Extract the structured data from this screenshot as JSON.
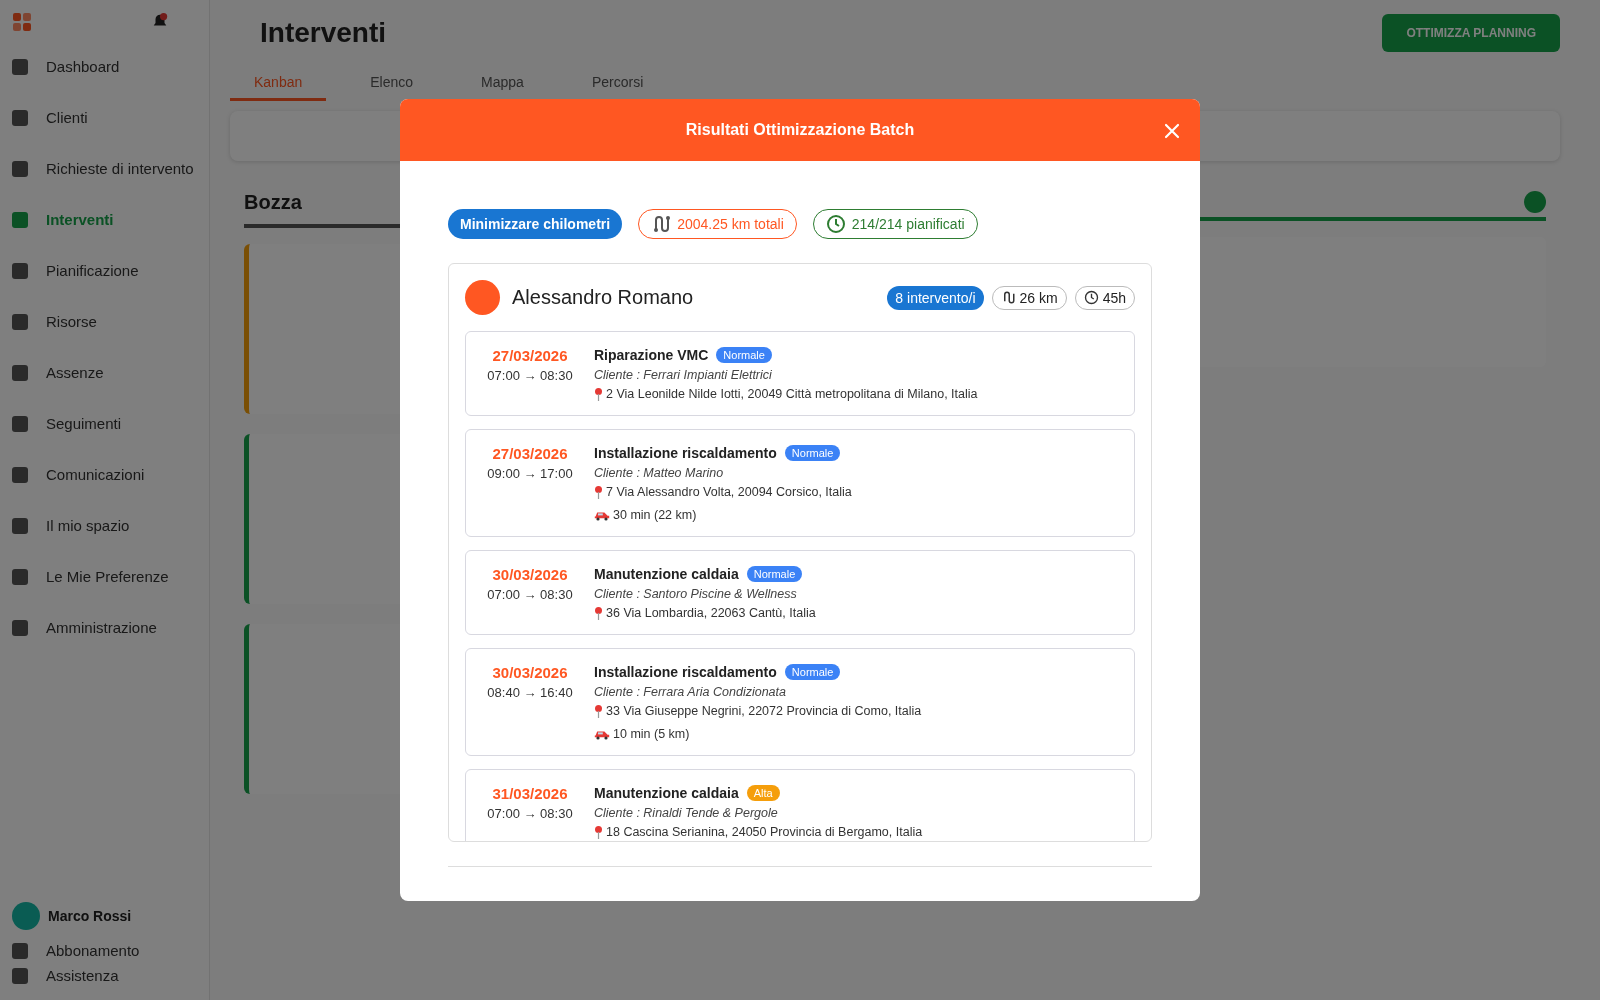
{
  "sidebar": {
    "items": [
      {
        "label": "Dashboard",
        "selected": false
      },
      {
        "label": "Clienti",
        "selected": false
      },
      {
        "label": "Richieste di intervento",
        "selected": false
      },
      {
        "label": "Interventi",
        "selected": true
      },
      {
        "label": "Pianificazione",
        "selected": false
      },
      {
        "label": "Risorse",
        "selected": false
      },
      {
        "label": "Assenze",
        "selected": false
      },
      {
        "label": "Seguimenti",
        "selected": false
      },
      {
        "label": "Comunicazioni",
        "selected": false
      },
      {
        "label": "Il mio spazio",
        "selected": false
      },
      {
        "label": "Le Mie Preferenze",
        "selected": false
      },
      {
        "label": "Amministrazione",
        "selected": false
      }
    ],
    "user": {
      "name": "Marco Rossi"
    },
    "footer_items": [
      "Abbonamento",
      "Assistenza"
    ]
  },
  "page": {
    "title": "Interventi",
    "action_button": "OTTIMIZZA PLANNING",
    "tabs": [
      {
        "label": "Kanban",
        "selected": true
      },
      {
        "label": "Elenco",
        "selected": false
      },
      {
        "label": "Mappa",
        "selected": false
      },
      {
        "label": "Percorsi",
        "selected": false
      }
    ],
    "columns": [
      {
        "title": "Bozza"
      }
    ]
  },
  "modal": {
    "title": "Risultati Ottimizzazione Batch",
    "chips": [
      {
        "kind": "mode",
        "label": "Minimizzare chilometri"
      },
      {
        "kind": "distance",
        "label": "2004.25 km totali"
      },
      {
        "kind": "planned",
        "label": "214/214 pianificati"
      }
    ],
    "resource": {
      "name": "Alessandro Romano",
      "count": "8 intervento/i",
      "km": "26 km",
      "hours": "45h",
      "interventions": [
        {
          "date": "27/03/2026",
          "time": "07:00 → 08:30",
          "title": "Riparazione VMC",
          "priority": {
            "kind": "normal",
            "label": "Normale"
          },
          "client": "Cliente : Ferrari Impianti Elettrici",
          "address": "2 Via Leonilde Nilde Iotti, 20049 Città metropolitana di Milano, Italia"
        },
        {
          "date": "27/03/2026",
          "time": "09:00 → 17:00",
          "title": "Installazione riscaldamento",
          "priority": {
            "kind": "normal",
            "label": "Normale"
          },
          "client": "Cliente : Matteo Marino",
          "address": "7 Via Alessandro Volta, 20094 Corsico, Italia",
          "travel": "30 min (22 km)"
        },
        {
          "date": "30/03/2026",
          "time": "07:00 → 08:30",
          "title": "Manutenzione caldaia",
          "priority": {
            "kind": "normal",
            "label": "Normale"
          },
          "client": "Cliente : Santoro Piscine & Wellness",
          "address": "36 Via Lombardia, 22063 Cantù, Italia"
        },
        {
          "date": "30/03/2026",
          "time": "08:40 → 16:40",
          "title": "Installazione riscaldamento",
          "priority": {
            "kind": "normal",
            "label": "Normale"
          },
          "client": "Cliente : Ferrara Aria Condizionata",
          "address": "33 Via Giuseppe Negrini, 22072 Provincia di Como, Italia",
          "travel": "10 min (5 km)"
        },
        {
          "date": "31/03/2026",
          "time": "07:00 → 08:30",
          "title": "Manutenzione caldaia",
          "priority": {
            "kind": "high",
            "label": "Alta"
          },
          "client": "Cliente : Rinaldi Tende & Pergole",
          "address": "18 Cascina Serianina, 24050 Provincia di Bergamo, Italia"
        }
      ]
    }
  }
}
